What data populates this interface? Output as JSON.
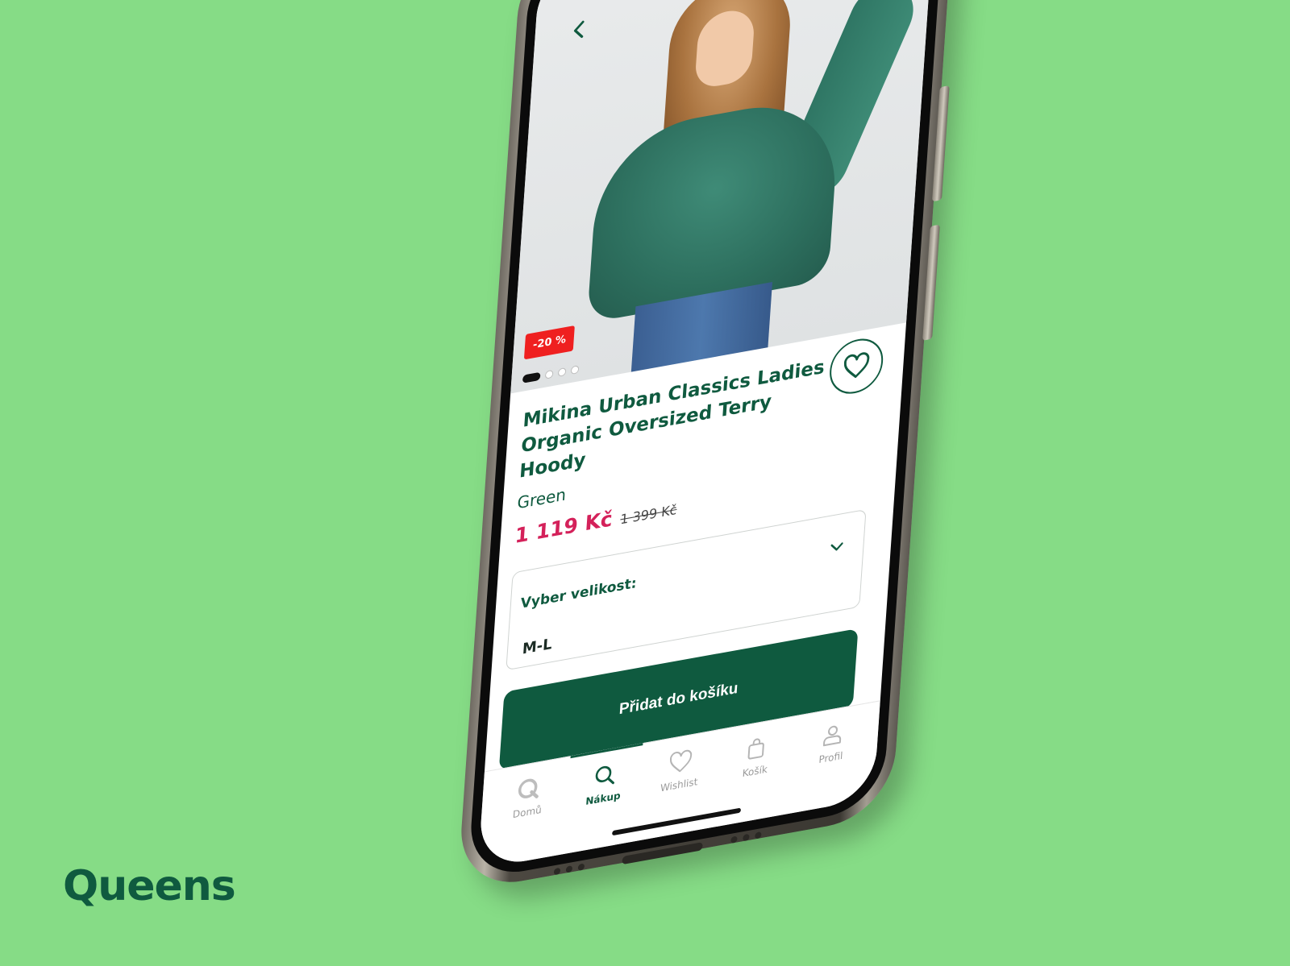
{
  "brand": {
    "name": "Queens"
  },
  "product": {
    "discount_badge": "-20 %",
    "title": "Mikina Urban Classics Ladies Organic Oversized Terry Hoody",
    "color": "Green",
    "price_current": "1 119 Kč",
    "price_original": "1 399 Kč",
    "image_dots": {
      "total": 4,
      "active_index": 0
    }
  },
  "size_select": {
    "label": "Vyber velikost:",
    "value": "M-L"
  },
  "actions": {
    "add_to_cart": "Přidat do košíku"
  },
  "tabbar": {
    "items": [
      {
        "label": "Domů",
        "icon": "queens-logo-icon",
        "active": false
      },
      {
        "label": "Nákup",
        "icon": "search-icon",
        "active": true
      },
      {
        "label": "Wishlist",
        "icon": "heart-icon",
        "active": false
      },
      {
        "label": "Košík",
        "icon": "bag-icon",
        "active": false
      },
      {
        "label": "Profil",
        "icon": "user-icon",
        "active": false
      }
    ]
  },
  "colors": {
    "background": "#86dc86",
    "brand_green": "#0f5a3f",
    "price_red": "#d4215a",
    "badge_red": "#ef2020"
  }
}
